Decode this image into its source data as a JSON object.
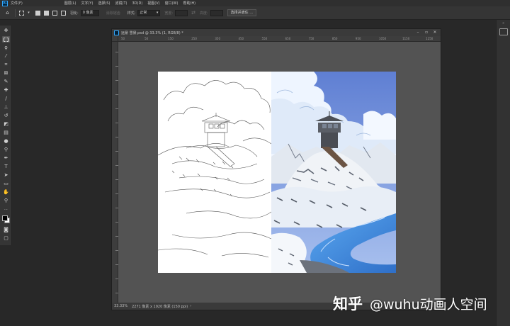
{
  "menubar": {
    "items": [
      "文件(F)",
      "图层(L)",
      "文字(Y)",
      "选择(S)",
      "滤镜(T)",
      "3D(D)",
      "视图(V)",
      "窗口(W)",
      "帮助(H)"
    ]
  },
  "options_bar": {
    "feather_label": "羽化:",
    "feather_value": "0 像素",
    "antialias_label": "消除锯齿",
    "style_label": "样式:",
    "style_value": "正常",
    "width_label": "宽度:",
    "height_label": "高度:",
    "select_subject_button": "选择并遮住 ..."
  },
  "document": {
    "title": "远景 雪景.psd @ 33.3% (1, RGB/8) *",
    "ruler_ticks": [
      "50",
      "0",
      "50",
      "100",
      "150",
      "200",
      "250",
      "300",
      "350",
      "400",
      "450",
      "500",
      "550",
      "600",
      "650",
      "700",
      "750",
      "800",
      "850",
      "900",
      "950",
      "1000",
      "1050",
      "1100",
      "1150",
      "1200",
      "1250",
      "1300",
      "1350",
      "1400",
      "1450",
      "1500",
      "1550",
      "1600",
      "1650",
      "1700",
      "1750",
      "1800",
      "1850",
      "1900",
      "1950",
      "2000",
      "2050",
      "2100",
      "2150",
      "2200",
      "2250",
      "2300",
      "2350",
      "2400",
      "2450",
      "2500",
      "2550",
      "2600",
      "2650"
    ],
    "status_zoom": "33.33%",
    "status_info": "2271 像素 x 1920 像素 (150 ppi)",
    "status_arrow": "›"
  },
  "watermark": {
    "brand": "知乎",
    "handle": "@wuhu动画人空间"
  },
  "colors": {
    "app_bg": "#282828",
    "panel": "#353535",
    "pasteboard": "#535353",
    "sky_blue": "#6b8fd8",
    "river_blue": "#4a8fd8",
    "ps_blue": "#31a8ff"
  }
}
